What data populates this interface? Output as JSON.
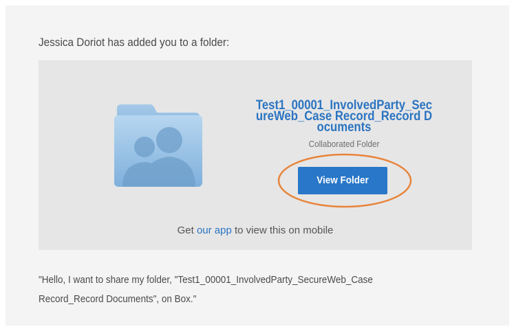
{
  "email": {
    "intro_text": "Jessica Doriot has added you to a folder:",
    "folder": {
      "name": "Test1_00001_InvolvedParty_SecureWeb_Case Record_Record Documents",
      "type_label": "Collaborated Folder",
      "icon": "shared-folder-icon"
    },
    "view_button_label": "View Folder",
    "mobile": {
      "prefix": "Get ",
      "link_text": "our app",
      "suffix": " to view this on mobile"
    },
    "message": "\"Hello, I want to share my folder, \"Test1_00001_InvolvedParty_SecureWeb_Case Record_Record Documents\", on Box.\""
  },
  "colors": {
    "card_background": "#f4f4f4",
    "panel_background": "#e6e6e6",
    "link_blue": "#2b74c1",
    "button_blue": "#2877c8",
    "highlight_orange": "#e8843a"
  }
}
